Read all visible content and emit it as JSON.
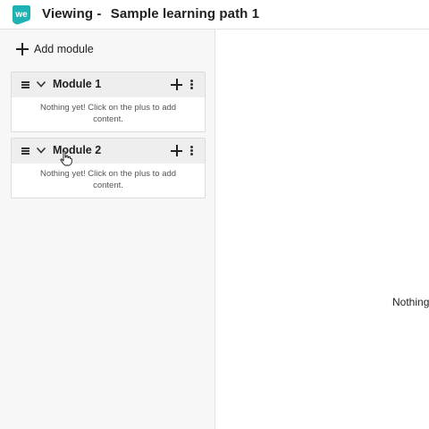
{
  "header": {
    "logo_text": "we",
    "title_prefix": "Viewing -",
    "title": "Sample learning path 1"
  },
  "sidebar": {
    "add_module_label": "Add module",
    "modules": [
      {
        "title": "Module 1",
        "empty_text": "Nothing yet! Click on the plus to add content."
      },
      {
        "title": "Module 2",
        "empty_text": "Nothing yet! Click on the plus to add content."
      }
    ]
  },
  "main": {
    "empty_text": "Nothing"
  },
  "colors": {
    "brand": "#1eb2b5",
    "sidebar_bg": "#f7f7f7",
    "module_header_bg": "#eeeeee"
  }
}
